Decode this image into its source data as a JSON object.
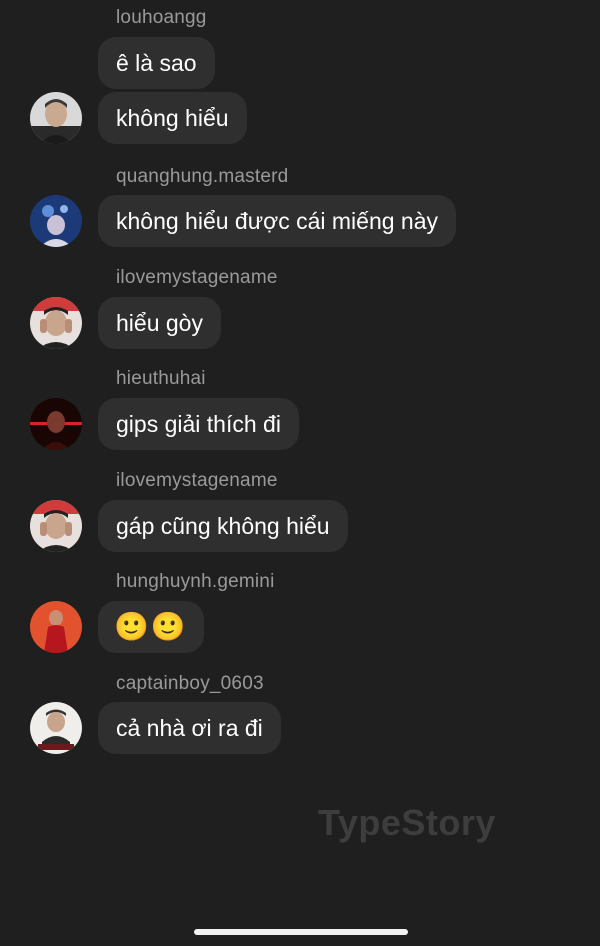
{
  "messages": [
    {
      "user": "louhoangg",
      "text": "ê là sao"
    },
    {
      "user": "",
      "text": "không hiểu"
    },
    {
      "user": "quanghung.masterd",
      "text": "không hiểu được cái miếng này"
    },
    {
      "user": "ilovemystagename",
      "text": "hiểu gòy"
    },
    {
      "user": "hieuthuhai",
      "text": "gips giải thích đi"
    },
    {
      "user": "ilovemystagename",
      "text": "gáp cũng không hiểu"
    },
    {
      "user": "hunghuynh.gemini",
      "text": "🙂🙂"
    },
    {
      "user": "captainboy_0603",
      "text": "cả nhà ơi ra đi"
    }
  ],
  "watermark": "TypeStory",
  "colors": {
    "background": "#1f1f1f",
    "bubble": "#2f2f2f",
    "username": "#9a9a9a",
    "text": "#ffffff"
  }
}
